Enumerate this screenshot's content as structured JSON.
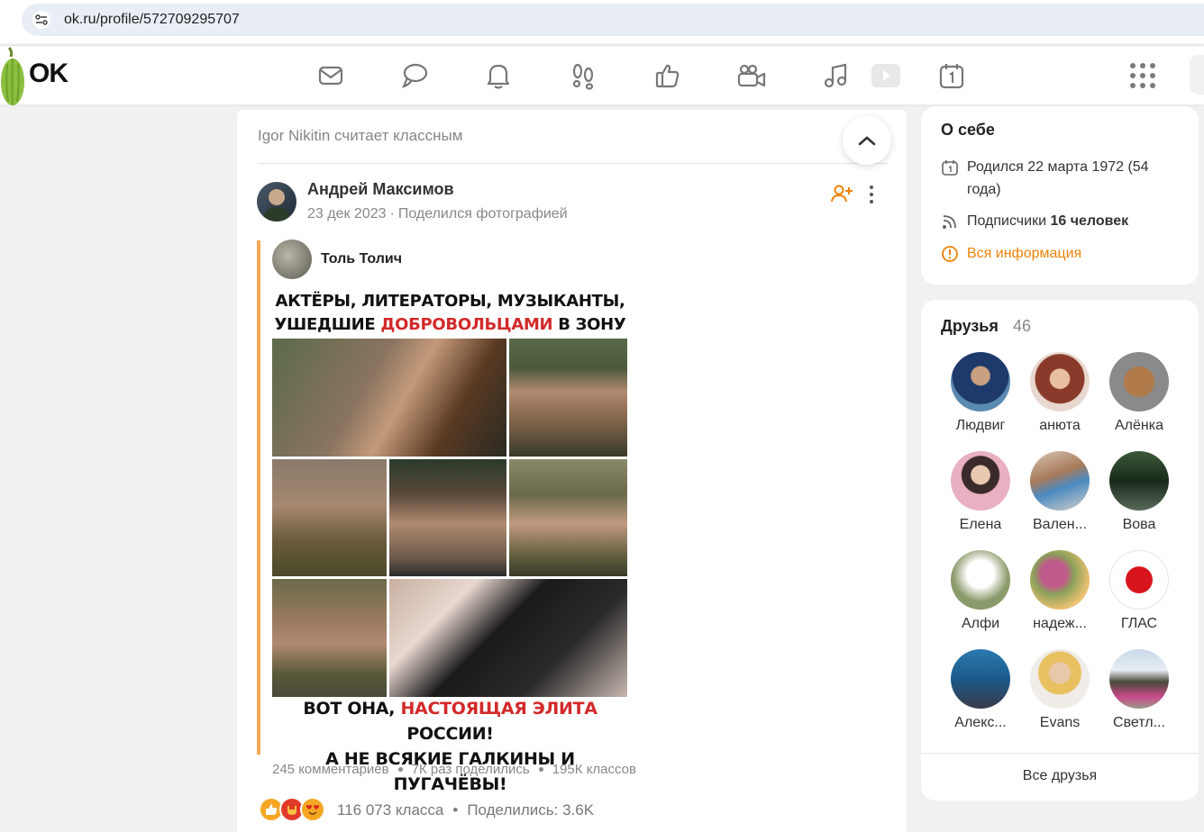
{
  "browser": {
    "url": "ok.ru/profile/572709295707"
  },
  "header": {
    "logo": "OK",
    "nav_icons": [
      "mail-icon",
      "chat-icon",
      "bell-icon",
      "footprints-icon",
      "like-icon",
      "video-camera-icon",
      "music-icon",
      "play-icon",
      "calendar-icon"
    ],
    "apps_icon": "grid-icon"
  },
  "feed": {
    "likes_line": "Igor Nikitin считает классным",
    "post": {
      "author": "Андрей Максимов",
      "date": "23 дек 2023",
      "action": "Поделился фотографией",
      "repost_author": "Толь Толич",
      "poster": {
        "head_1": "АКТЁРЫ, ЛИТЕРАТОРЫ, МУЗЫКАНТЫ,",
        "head_2a": "УШЕДШИЕ ",
        "head_2b": "ДОБРОВОЛЬЦАМИ",
        "head_2c": " В ЗОНУ СВО:",
        "foot_1a": "ВОТ ОНА, ",
        "foot_1b": "НАСТОЯЩАЯ ЭЛИТА",
        "foot_1c": " РОССИИ!",
        "foot_2": "А НЕ ВСЯКИЕ ГАЛКИНЫ И ПУГАЧЁВЫ!"
      },
      "stats": {
        "comments": "245 комментариев",
        "shares": "7К раз поделились",
        "classes": "195К классов"
      },
      "reactions_text": "116 073 класса",
      "shared_text": "Поделились: 3.6K"
    }
  },
  "about": {
    "title": "О себе",
    "born": "Родился 22 марта 1972 (54",
    "born_2": "года)",
    "subscribers_label": "Подписчики ",
    "subscribers_value": "16 человек",
    "all_info": "Вся информация",
    "accent": "#ee8208"
  },
  "friends": {
    "title": "Друзья",
    "count": "46",
    "list": [
      "Людвиг",
      "анюта",
      "Алёнка",
      "Елена",
      "Вален...",
      "Вова",
      "Алфи",
      "надеж...",
      "ГЛАС",
      "Алекс...",
      "Evans",
      "Светл..."
    ],
    "all_label": "Все друзья"
  }
}
